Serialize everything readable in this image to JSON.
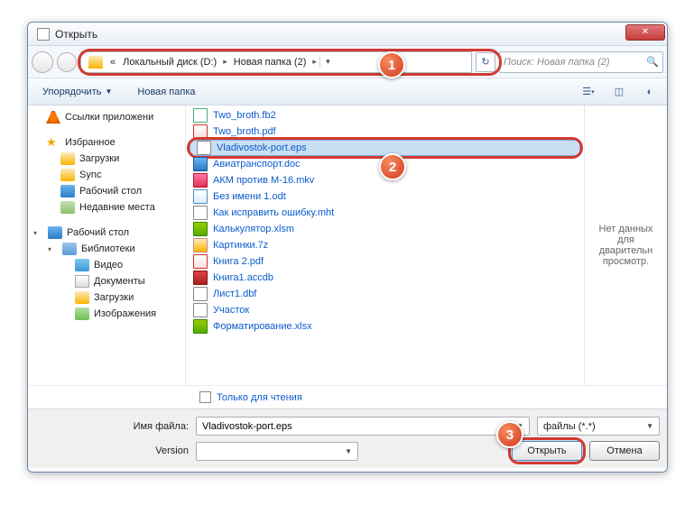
{
  "window": {
    "title": "Открыть"
  },
  "nav": {
    "seg_root": "«",
    "seg1": "Локальный диск (D:)",
    "seg2": "Новая папка (2)",
    "search_placeholder": "Поиск: Новая папка (2)"
  },
  "toolbar": {
    "organize": "Упорядочить",
    "new_folder": "Новая папка"
  },
  "sidebar": {
    "app_links": "Ссылки приложени",
    "favorites": "Избранное",
    "downloads": "Загрузки",
    "sync": "Sync",
    "desktop": "Рабочий стол",
    "recent": "Недавние места",
    "desktop2": "Рабочий стол",
    "libraries": "Библиотеки",
    "videos": "Видео",
    "documents": "Документы",
    "downloads2": "Загрузки",
    "pictures": "Изображения"
  },
  "files": [
    {
      "name": "Two_broth.fb2",
      "type": "fb2"
    },
    {
      "name": "Two_broth.pdf",
      "type": "pdf"
    },
    {
      "name": "Vladivostok-port.eps",
      "type": "eps",
      "selected": true
    },
    {
      "name": "Авиатранспорт.doc",
      "type": "doc"
    },
    {
      "name": "АКМ против М-16.mkv",
      "type": "mkv"
    },
    {
      "name": "Без имени 1.odt",
      "type": "odt"
    },
    {
      "name": "Как исправить ошибку.mht",
      "type": "mht"
    },
    {
      "name": "Калькулятор.xlsm",
      "type": "xlsx"
    },
    {
      "name": "Картинки.7z",
      "type": "7z"
    },
    {
      "name": "Книга 2.pdf",
      "type": "pdf"
    },
    {
      "name": "Книга1.accdb",
      "type": "accdb"
    },
    {
      "name": "Лист1.dbf",
      "type": "dbf"
    },
    {
      "name": "Участок",
      "type": "dbf"
    },
    {
      "name": "Форматирование.xlsx",
      "type": "xlsx"
    }
  ],
  "preview": {
    "text": "Нет данных для дварительн просмотр."
  },
  "options": {
    "readonly": "Только для чтения"
  },
  "footer": {
    "filename_label": "Имя файла:",
    "filename_value": "Vladivostok-port.eps",
    "filetype": "файлы (*.*)",
    "version_label": "Version",
    "open_btn": "Открыть",
    "cancel_btn": "Отмена"
  },
  "badges": {
    "b1": "1",
    "b2": "2",
    "b3": "3"
  }
}
